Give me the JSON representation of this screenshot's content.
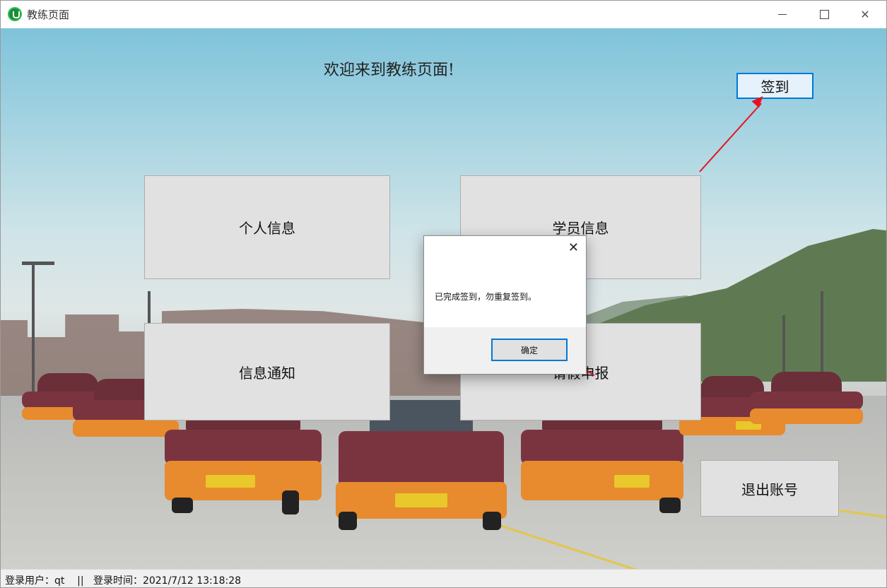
{
  "window": {
    "title": "教练页面",
    "controls": {
      "minimize": "minimize-icon",
      "maximize": "maximize-icon",
      "close": "close-icon"
    }
  },
  "main": {
    "welcome": "欢迎来到教练页面!",
    "signin_label": "签到",
    "personal_info_label": "个人信息",
    "student_info_label": "学员信息",
    "notice_label": "信息通知",
    "leave_label": "请假申报",
    "logout_label": "退出账号"
  },
  "dialog": {
    "message": "已完成签到，勿重复签到。",
    "close_icon": "close-icon",
    "ok_label": "确定"
  },
  "status": {
    "text": "登录用户：qt    ||   登录时间：2021/7/12 13:18:28"
  },
  "colors": {
    "accent": "#0078d7",
    "annotation_arrow": "#e81123",
    "button_face": "#e1e1e1"
  }
}
